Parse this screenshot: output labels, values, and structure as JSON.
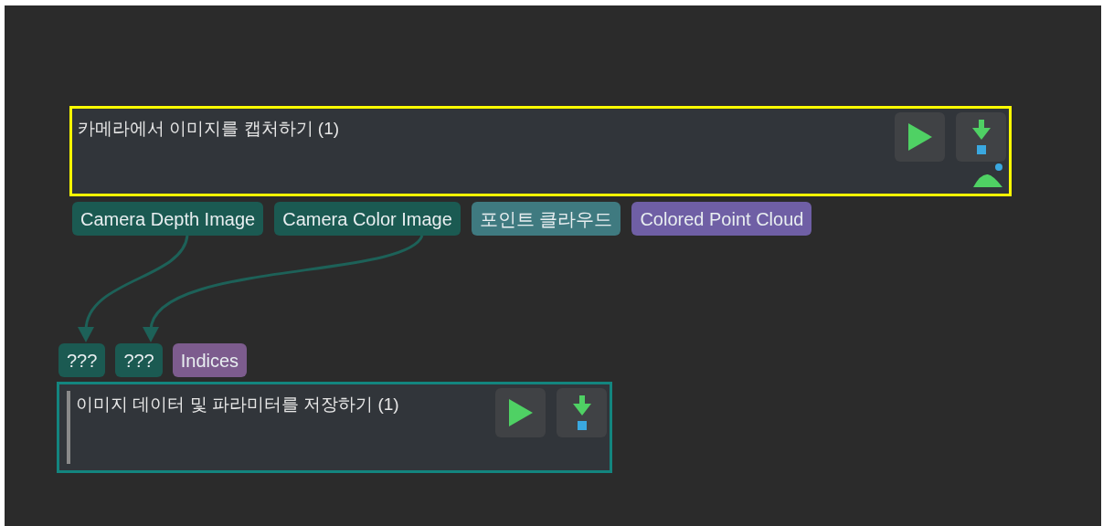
{
  "nodes": [
    {
      "kind": "capture",
      "title": "카메라에서 이미지를 캡처하기 (1)",
      "selected": true,
      "outputs": [
        {
          "label": "Camera Depth Image",
          "color": "#1b5a52"
        },
        {
          "label": "Camera Color Image",
          "color": "#1b5a52"
        },
        {
          "label": "포인트 클라우드",
          "color": "#3f7a80"
        },
        {
          "label": "Colored Point Cloud",
          "color": "#6f5fa5"
        }
      ]
    },
    {
      "kind": "save",
      "title": "이미지 데이터 및 파라미터를 저장하기 (1)",
      "selected": false,
      "inputs": [
        {
          "label": "???",
          "color": "#1b5a52"
        },
        {
          "label": "???",
          "color": "#1b5a52"
        },
        {
          "label": "Indices",
          "color": "#7d5c8e"
        }
      ]
    }
  ]
}
